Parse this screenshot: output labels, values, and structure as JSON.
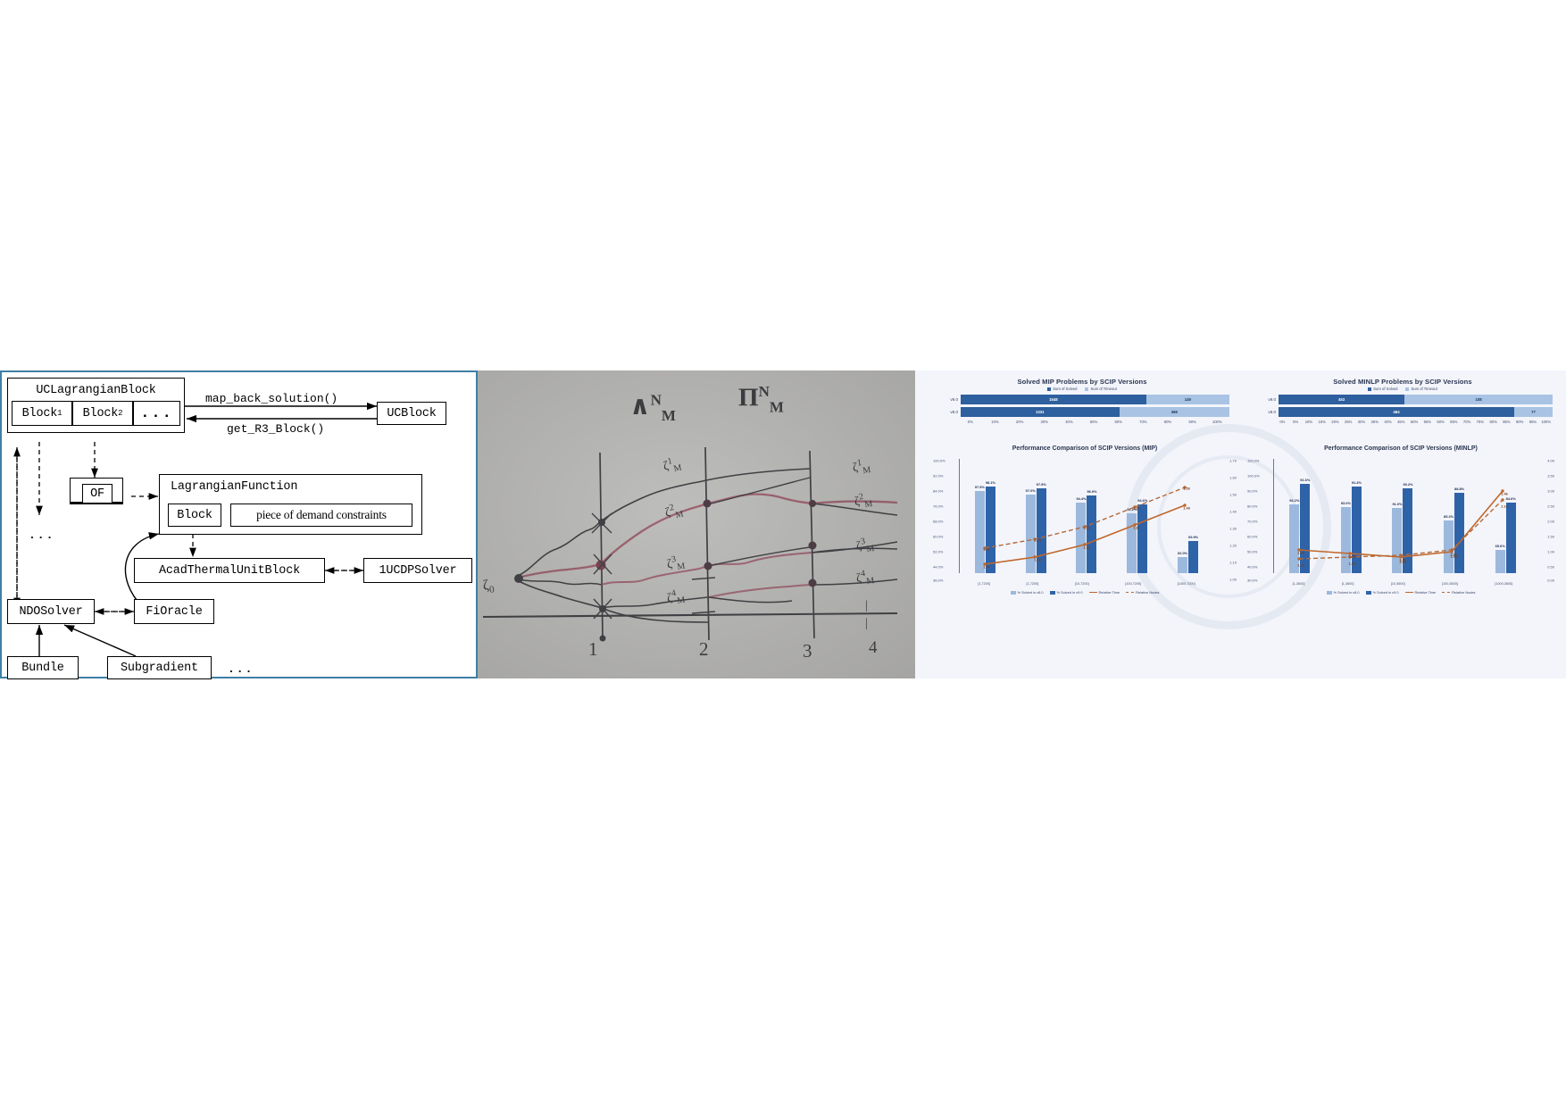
{
  "figure": {
    "panels": [
      "architecture-diagram",
      "whiteboard-photo",
      "scip-dashboard"
    ]
  },
  "diagram": {
    "uc_lagrangian_block": "UCLagrangianBlock",
    "block1": "Block",
    "block1_sub": "1",
    "block2": "Block",
    "block2_sub": "2",
    "block_ellipsis": "...",
    "side_ellipsis": "...",
    "ucblock": "UCBlock",
    "arrow_top_label": "map_back_solution()",
    "arrow_bottom_label": "get_R3_Block()",
    "of": "OF",
    "lagrangian_function": "LagrangianFunction",
    "lf_block": "Block",
    "lf_demand": "piece of demand constraints",
    "acad_thermal": "AcadThermalUnitBlock",
    "ucdp_solver": "1UCDPSolver",
    "ndo_solver": "NDOSolver",
    "fi_oracle": "FiOracle",
    "bundle": "Bundle",
    "subgradient": "Subgradient",
    "bottom_ellipsis": "..."
  },
  "whiteboard": {
    "labels": [
      {
        "text": "∇",
        "sup": "N",
        "sub": "M"
      },
      {
        "text": "Π",
        "sup": "N",
        "sub": "M"
      }
    ],
    "symbol_gamma_1": "ζ",
    "node_labels": [
      "ζ¹ₘ",
      "ζ²ₘ",
      "ζ³ₘ",
      "ζ⁴ₘ"
    ],
    "right_labels": [
      "ζ¹ₘ",
      "ζ²ₘ",
      "ζ³ₘ",
      "ζ⁴ₘ"
    ],
    "origin_label": "ζ₀",
    "axis_ticks": [
      "1",
      "2",
      "3",
      "4"
    ],
    "dashes": [
      "|",
      "|"
    ]
  },
  "dashboard": {
    "colors": {
      "bar_light": "#9cb9dd",
      "bar_dark": "#2f63a8",
      "line_time": "#c1662a",
      "line_nodes": "#b5693a",
      "background": "#f3f5fb"
    },
    "stacked_mip": {
      "title": "Solved MIP Problems by SCIP Versions",
      "legend": [
        "Sum of Solved",
        "Sum of Timeout"
      ],
      "rows": [
        {
          "label": "v9.0",
          "solved": "1548",
          "timeout": "149"
        },
        {
          "label": "v8.0",
          "solved": "1331",
          "timeout": "366"
        }
      ],
      "axis": [
        "0%",
        "10%",
        "20%",
        "30%",
        "40%",
        "50%",
        "60%",
        "70%",
        "80%",
        "90%",
        "100%"
      ]
    },
    "stacked_minlp": {
      "title": "Solved MINLP Problems by SCIP Versions",
      "legend": [
        "Sum of Solved",
        "Sum of Timeout"
      ],
      "rows": [
        {
          "label": "v9.0",
          "solved": "453",
          "timeout": "108"
        },
        {
          "label": "v8.0",
          "solved": "484",
          "timeout": "77"
        }
      ],
      "axis": [
        "0%",
        "5%",
        "10%",
        "15%",
        "20%",
        "25%",
        "30%",
        "35%",
        "40%",
        "45%",
        "50%",
        "55%",
        "60%",
        "65%",
        "70%",
        "75%",
        "80%",
        "85%",
        "90%",
        "95%",
        "100%"
      ]
    },
    "mip_chart": {
      "title": "Performance Comparison of SCIP Versions (MIP)",
      "legend": [
        "% Solved in v8.0",
        "% Solved in v9.0",
        "Relative Time",
        "Relative Nodes"
      ],
      "ylabel_ticks": [
        "100.0%",
        "92.0%",
        "84.0%",
        "76.0%",
        "68.0%",
        "60.0%",
        "52.0%",
        "44.0%",
        "36.0%"
      ],
      "y2_ticks": [
        "1.70",
        "1.60",
        "1.50",
        "1.40",
        "1.30",
        "1.20",
        "1.10",
        "1.00"
      ],
      "categories": [
        "[1,7200]",
        "[1,7200]",
        "[10,7200]",
        "[100,7200]",
        "[1000,7200]"
      ],
      "series_solved_v8": [
        "97.5%",
        "97.0%",
        "94.4%",
        "91.2%",
        "60.0%"
      ],
      "series_solved_v9": [
        "98.1%",
        "97.9%",
        "96.9%",
        "94.6%",
        "69.9%"
      ],
      "relative_time": [
        "1.04",
        "1.10",
        "1.18",
        "1.32",
        "1.49"
      ],
      "relative_nodes": [
        "1.11",
        "1.14",
        "1.18",
        "1.25",
        "1.53"
      ]
    },
    "minlp_chart": {
      "title": "Performance Comparison of SCIP Versions (MINLP)",
      "legend": [
        "% Solved in v8.0",
        "% Solved in v9.0",
        "Relative Time",
        "Relative Nodes"
      ],
      "ylabel_ticks": [
        "110.0%",
        "100.0%",
        "90.0%",
        "80.0%",
        "70.0%",
        "60.0%",
        "50.0%",
        "40.0%",
        "30.0%"
      ],
      "y2_ticks": [
        "4.00",
        "3.50",
        "3.00",
        "2.50",
        "2.00",
        "1.50",
        "1.00",
        "0.50",
        "0.00"
      ],
      "categories": [
        "[1,3600]",
        "[1,3600]",
        "[10,3600]",
        "[100,3600]",
        "[1000,3600]"
      ],
      "series_solved_v8": [
        "93.2%",
        "93.0%",
        "91.0%",
        "85.2%",
        "65.6%"
      ],
      "series_solved_v9": [
        "91.6%",
        "91.4%",
        "90.2%",
        "88.8%",
        "84.6%"
      ],
      "relative_time": [
        "1.49",
        "1.40",
        "1.31",
        "1.36",
        "2.46"
      ],
      "relative_nodes": [
        "1.23",
        "1.26",
        "1.29",
        "1.38",
        "2.14"
      ]
    }
  }
}
